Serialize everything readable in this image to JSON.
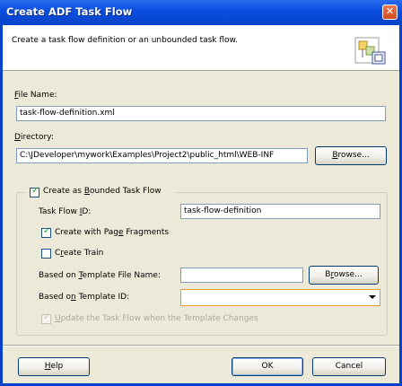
{
  "window": {
    "title": "Create ADF Task Flow",
    "close": "✕"
  },
  "header": {
    "description": "Create a task flow definition or an unbounded task flow.",
    "icon": "task-flow-icon"
  },
  "file_name": {
    "label_pre": "",
    "label_mnemonic": "F",
    "label_post": "ile Name:",
    "value": "task-flow-definition.xml"
  },
  "directory": {
    "label_mnemonic": "D",
    "label_post": "irectory:",
    "value": "C:\\JDeveloper\\mywork\\Examples\\Project2\\public_html\\WEB-INF",
    "browse_pre": "",
    "browse_mnemonic": "B",
    "browse_post": "rowse..."
  },
  "bounded": {
    "label_pre": "Create as ",
    "label_mnemonic": "B",
    "label_post": "ounded Task Flow",
    "checked": true
  },
  "task_flow_id": {
    "label_pre": "Task Flow ",
    "label_mnemonic": "I",
    "label_post": "D:",
    "value": "task-flow-definition"
  },
  "page_fragments": {
    "label_pre": "Create with Pag",
    "label_mnemonic": "e",
    "label_post": " Fragments",
    "checked": true
  },
  "create_train": {
    "label_pre": "C",
    "label_mnemonic": "r",
    "label_post": "eate Train",
    "checked": false
  },
  "template_file": {
    "label_pre": "Based on ",
    "label_mnemonic": "T",
    "label_post": "emplate File Name:",
    "value": "",
    "browse_pre": "B",
    "browse_mnemonic": "r",
    "browse_post": "owse..."
  },
  "template_id": {
    "label_pre": "Based o",
    "label_mnemonic": "n",
    "label_post": " Template ID:",
    "value": ""
  },
  "update_flow": {
    "label_pre": "",
    "label_mnemonic": "U",
    "label_post": "pdate the Task Flow when the Template Changes",
    "checked": true,
    "enabled": false
  },
  "buttons": {
    "help_pre": "",
    "help_mnemonic": "H",
    "help_post": "elp",
    "ok": "OK",
    "cancel": "Cancel"
  }
}
